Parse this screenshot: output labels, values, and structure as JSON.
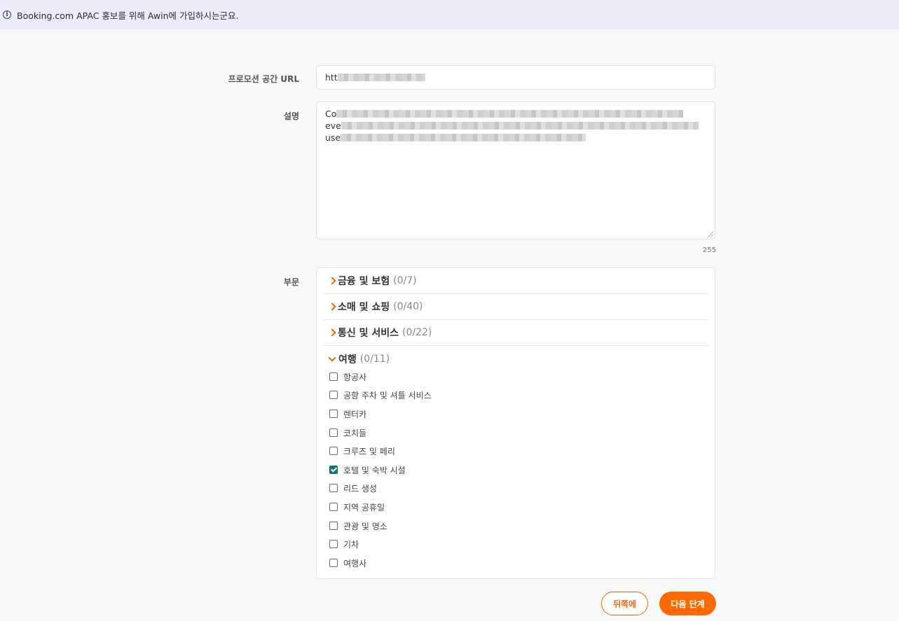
{
  "banner": {
    "icon": "info-icon",
    "text": "Booking.com APAC 홍보를 위해 Awin에 가입하시는군요."
  },
  "form": {
    "url_label": "프로모션 공간 URL",
    "url_value_visible": "htt",
    "description_label": "설명",
    "description_lines_visible": [
      "Co",
      "eve",
      "use"
    ],
    "char_count": "255",
    "sector_label": "부문"
  },
  "sectors": [
    {
      "name": "금융 및 보험",
      "count": "(0/7)",
      "expanded": false
    },
    {
      "name": "소매 및 쇼핑",
      "count": "(0/40)",
      "expanded": false
    },
    {
      "name": "통신 및 서비스",
      "count": "(0/22)",
      "expanded": false
    },
    {
      "name": "여행",
      "count": "(0/11)",
      "expanded": true
    }
  ],
  "travel_items": [
    {
      "label": "항공사",
      "checked": false
    },
    {
      "label": "공항 주차 및 셔틀 서비스",
      "checked": false
    },
    {
      "label": "렌터카",
      "checked": false
    },
    {
      "label": "코치들",
      "checked": false
    },
    {
      "label": "크루즈 및 페리",
      "checked": false
    },
    {
      "label": "호텔 및 숙박 시설",
      "checked": true
    },
    {
      "label": "리드 생성",
      "checked": false
    },
    {
      "label": "지역 공휴일",
      "checked": false
    },
    {
      "label": "관광 및 명소",
      "checked": false
    },
    {
      "label": "기차",
      "checked": false
    },
    {
      "label": "여행사",
      "checked": false
    }
  ],
  "buttons": {
    "back": "뒤쪽에",
    "next": "다음 단계"
  },
  "colors": {
    "accent": "#ff6a00",
    "checkbox_checked": "#1b6b73",
    "banner_bg": "#ececf8"
  }
}
